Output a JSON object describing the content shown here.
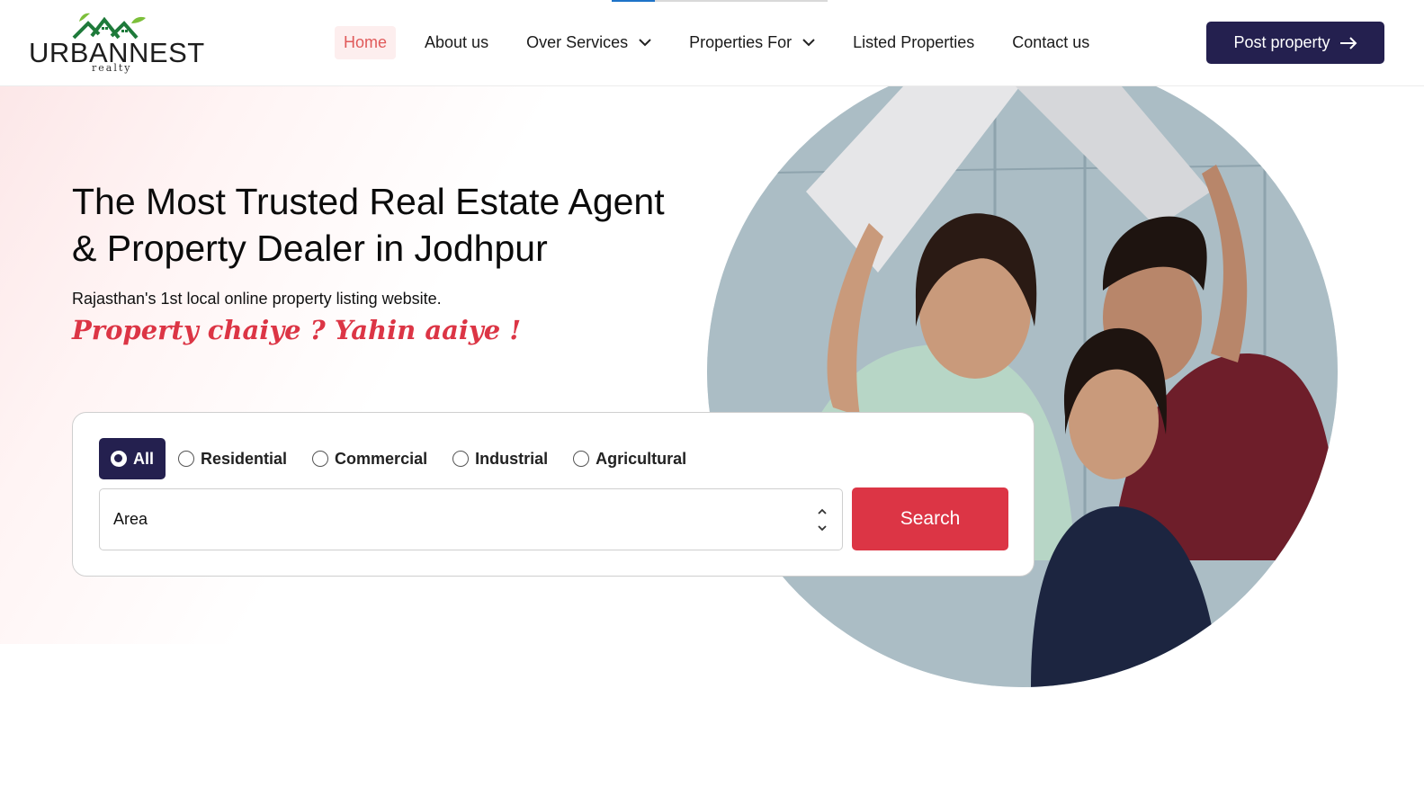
{
  "header": {
    "logo": {
      "brand": "URBANNEST",
      "sub": "realty",
      "icon": "house-roofs-logo-icon"
    },
    "nav": [
      {
        "label": "Home",
        "active": true
      },
      {
        "label": "About us"
      },
      {
        "label": "Over Services",
        "dropdown": true
      },
      {
        "label": "Properties For",
        "dropdown": true
      },
      {
        "label": "Listed Properties"
      },
      {
        "label": "Contact us"
      }
    ],
    "post_button": {
      "label": "Post property",
      "icon": "arrow-right-icon"
    }
  },
  "hero": {
    "headline_line1": "The Most Trusted Real Estate Agent",
    "headline_line2": "& Property Dealer in Jodhpur",
    "subline": "Rajasthan's 1st local online property listing website.",
    "tagline": "Property chaiye ? Yahin aaiye !",
    "image": "family-under-paper-roof-photo"
  },
  "search": {
    "types": [
      {
        "label": "All",
        "selected": true
      },
      {
        "label": "Residential"
      },
      {
        "label": "Commercial"
      },
      {
        "label": "Industrial"
      },
      {
        "label": "Agricultural"
      }
    ],
    "area_select": {
      "value": "Area"
    },
    "search_button": "Search"
  },
  "colors": {
    "brand_navy": "#24204f",
    "accent_red": "#dc3545",
    "nav_active": "#e05a5a"
  }
}
